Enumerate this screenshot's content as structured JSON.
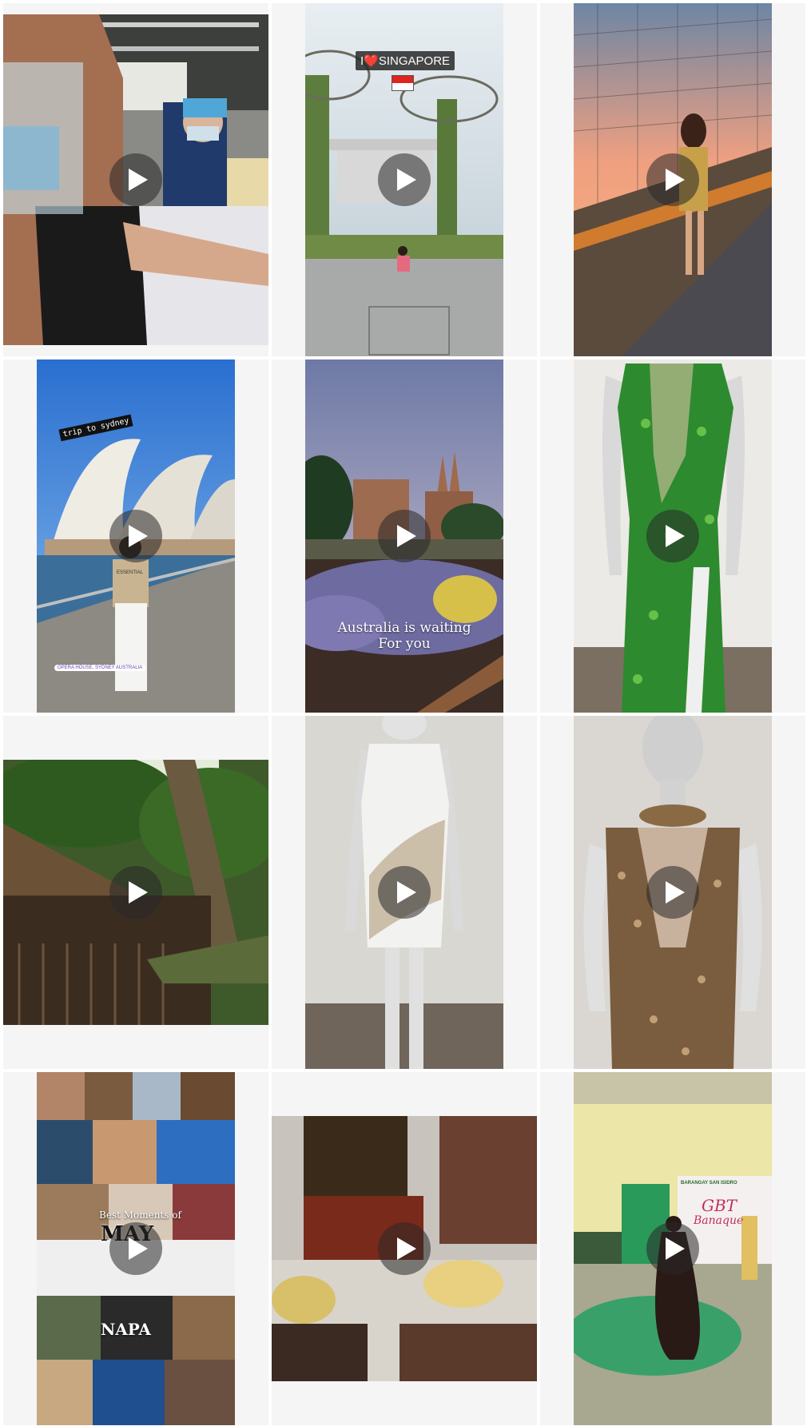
{
  "colors": {
    "cell_background": "#f5f5f5",
    "play_button": "rgba(40,40,40,0.55)"
  },
  "posts": [
    {
      "type": "video",
      "icon": "play-icon"
    },
    {
      "type": "video",
      "icon": "play-icon",
      "overlay_text": "I❤️SINGAPORE"
    },
    {
      "type": "video",
      "icon": "play-icon"
    },
    {
      "type": "video",
      "icon": "play-icon",
      "overlay_text": "trip to sydney",
      "location_tag": "OPERA HOUSE, SYDNEY AUSTRALIA",
      "shirt_text": "ESSENTIAL"
    },
    {
      "type": "video",
      "icon": "play-icon",
      "overlay_text": "Australia is waiting\nFor you"
    },
    {
      "type": "video",
      "icon": "play-icon"
    },
    {
      "type": "video",
      "icon": "play-icon"
    },
    {
      "type": "video",
      "icon": "play-icon"
    },
    {
      "type": "video",
      "icon": "play-icon"
    },
    {
      "type": "image",
      "overlay_text": "Best Moments of",
      "overlay_text_2": "MAY",
      "overlay_text_3": "NAPA"
    },
    {
      "type": "video",
      "icon": "play-icon"
    },
    {
      "type": "video",
      "icon": "play-icon",
      "banner_text": "BARANGAY SAN ISIDRO",
      "banner_sub": "GBT",
      "banner_sub2": "Banaque"
    }
  ]
}
